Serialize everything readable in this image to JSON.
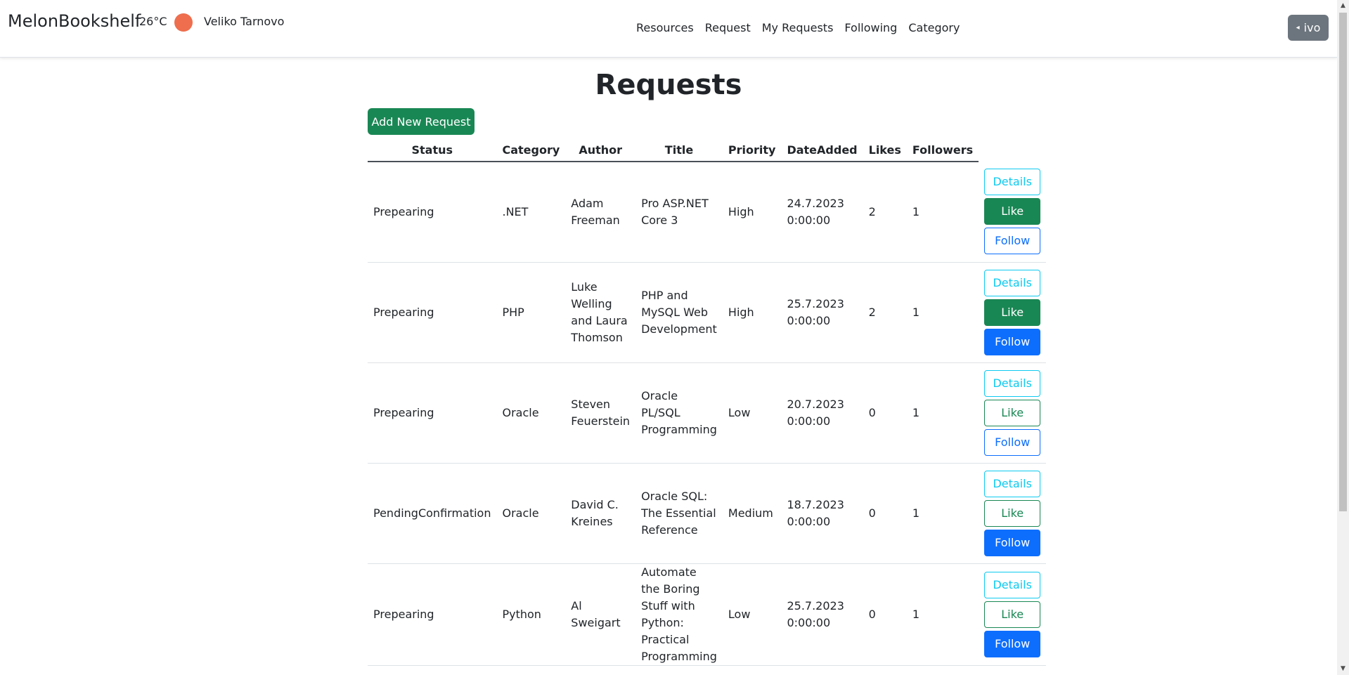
{
  "navbar": {
    "brand": "MelonBookshelf",
    "temperature": "26°C",
    "weather_icon": "sun-icon",
    "city": "Veliko Tarnovo",
    "links": [
      "Resources",
      "Request",
      "My Requests",
      "Following",
      "Category"
    ],
    "user": "ivo"
  },
  "page": {
    "title": "Requests",
    "add_button": "Add New Request"
  },
  "table": {
    "headers": [
      "Status",
      "Category",
      "Author",
      "Title",
      "Priority",
      "DateAdded",
      "Likes",
      "Followers"
    ],
    "rows": [
      {
        "status": "Prepearing",
        "category": ".NET",
        "author": "Adam Freeman",
        "title": "Pro ASP.NET Core 3",
        "priority": "High",
        "date": "24.7.2023 0:00:00",
        "likes": "2",
        "followers": "1",
        "details": "Details",
        "like": "Like",
        "follow": "Follow",
        "liked": true,
        "followed": false
      },
      {
        "status": "Prepearing",
        "category": "PHP",
        "author": "Luke Welling and Laura Thomson",
        "title": "PHP and MySQL Web Development",
        "priority": "High",
        "date": "25.7.2023 0:00:00",
        "likes": "2",
        "followers": "1",
        "details": "Details",
        "like": "Like",
        "follow": "Follow",
        "liked": true,
        "followed": true
      },
      {
        "status": "Prepearing",
        "category": "Oracle",
        "author": "Steven Feuerstein",
        "title": "Oracle PL/SQL Programming",
        "priority": "Low",
        "date": "20.7.2023 0:00:00",
        "likes": "0",
        "followers": "1",
        "details": "Details",
        "like": "Like",
        "follow": "Follow",
        "liked": false,
        "followed": false
      },
      {
        "status": "PendingConfirmation",
        "category": "Oracle",
        "author": "David C. Kreines",
        "title": "Oracle SQL: The Essential Reference",
        "priority": "Medium",
        "date": "18.7.2023 0:00:00",
        "likes": "0",
        "followers": "1",
        "details": "Details",
        "like": "Like",
        "follow": "Follow",
        "liked": false,
        "followed": true
      },
      {
        "status": "Prepearing",
        "category": "Python",
        "author": "Al Sweigart",
        "title": "Automate the Boring Stuff with Python: Practical Programming",
        "priority": "Low",
        "date": "25.7.2023 0:00:00",
        "likes": "0",
        "followers": "1",
        "details": "Details",
        "like": "Like",
        "follow": "Follow",
        "liked": false,
        "followed": true
      }
    ]
  },
  "colors": {
    "success": "#198754",
    "primary": "#0d6efd",
    "info": "#0dcaf0",
    "secondary": "#6c757d",
    "weather": "#ee6e4e"
  }
}
